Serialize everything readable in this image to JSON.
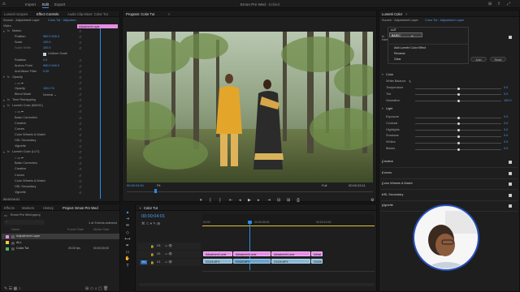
{
  "app": {
    "home_icon": "home-icon",
    "tabs": [
      "Import",
      "Edit",
      "Export"
    ],
    "active_tab": "Edit",
    "project_title": "Emon Pre Wed",
    "edited": "- Edited"
  },
  "effect_controls": {
    "tabs": [
      "Lumetri Scopes",
      "Effect Controls",
      "Audio Clip Mixer: Color Tut"
    ],
    "active_tab": "Effect Controls",
    "source": "Source · Adjustment Layer",
    "target": "Color Tut · Adjustme...",
    "clip_label": "Adjustment Layer",
    "section_video": "Video",
    "rows": [
      {
        "label": "Motion",
        "value": "",
        "indent": 0,
        "fx": true
      },
      {
        "label": "Position",
        "value": "960.0   540.0",
        "indent": 2
      },
      {
        "label": "Scale",
        "value": "100.0",
        "indent": 2
      },
      {
        "label": "Scale Width",
        "value": "100.0",
        "indent": 2,
        "dim": true
      },
      {
        "label": "",
        "value": "Uniform Scale",
        "indent": 3,
        "checkbox": true
      },
      {
        "label": "Rotation",
        "value": "0.0",
        "indent": 2
      },
      {
        "label": "Anchor Point",
        "value": "960.0   540.0",
        "indent": 2
      },
      {
        "label": "Anti-flicker Filter",
        "value": "0.00",
        "indent": 2
      },
      {
        "label": "Opacity",
        "value": "",
        "indent": 0,
        "fx": true
      },
      {
        "label": "",
        "value": "",
        "indent": 2,
        "shapes": true
      },
      {
        "label": "Opacity",
        "value": "100.0 %",
        "indent": 2
      },
      {
        "label": "Blend Mode",
        "value": "Normal",
        "indent": 2,
        "select": true
      },
      {
        "label": "Time Remapping",
        "value": "",
        "indent": 0,
        "fx": true
      },
      {
        "label": "Lumetri Color (BASIC)",
        "value": "",
        "indent": 0,
        "fx": true
      },
      {
        "label": "",
        "value": "",
        "indent": 2,
        "shapes": true
      },
      {
        "label": "Basic Correction",
        "value": "",
        "indent": 2
      },
      {
        "label": "Creative",
        "value": "",
        "indent": 2
      },
      {
        "label": "Curves",
        "value": "",
        "indent": 2
      },
      {
        "label": "Color Wheels & Match",
        "value": "",
        "indent": 2
      },
      {
        "label": "HSL Secondary",
        "value": "",
        "indent": 2
      },
      {
        "label": "Vignette",
        "value": "",
        "indent": 2
      },
      {
        "label": "Lumetri Color (LUT)",
        "value": "",
        "indent": 0,
        "fx": true
      },
      {
        "label": "",
        "value": "",
        "indent": 2,
        "shapes": true
      },
      {
        "label": "Basic Correction",
        "value": "",
        "indent": 2
      },
      {
        "label": "Creative",
        "value": "",
        "indent": 2
      },
      {
        "label": "Curves",
        "value": "",
        "indent": 2
      },
      {
        "label": "Color Wheels & Match",
        "value": "",
        "indent": 2
      },
      {
        "label": "HSL Secondary",
        "value": "",
        "indent": 2
      },
      {
        "label": "Vignette",
        "value": "",
        "indent": 2
      }
    ],
    "timecode": "00:00:04:01"
  },
  "program": {
    "title": "Program: Color Tut",
    "timecode_left": "00:00:04:01",
    "fit": "Fit",
    "quality": "Full",
    "timecode_right": "00:00:33:11"
  },
  "project": {
    "tabs": [
      "Effects",
      "Markers",
      "History",
      "Project: Emon Pre Wed"
    ],
    "active_tab": "Project: Emon Pre Wed",
    "file": "Emon Pre Wed.prproj",
    "selection": "1 of 3 items selected",
    "columns": [
      "Name",
      "Frame Rate",
      "Media Start"
    ],
    "items": [
      {
        "name": "Adjustment Layer",
        "rate": "",
        "start": "",
        "color": "#e48ee4",
        "selected": true
      },
      {
        "name": "ALL",
        "rate": "",
        "start": "",
        "color": "#f1c93a"
      },
      {
        "name": "Color Tut",
        "rate": "25.00 fps",
        "start": "00;00;00;00",
        "color": "#4cb75a"
      }
    ]
  },
  "timeline": {
    "tab": "Color Tut",
    "timecode": "00:00:04:01",
    "ruler": [
      "00:00",
      "00:00:05:00",
      "00:00:10:00"
    ],
    "tracks": [
      {
        "name": "V3",
        "active": false
      },
      {
        "name": "V2",
        "active": false
      },
      {
        "name": "V1",
        "active": true
      }
    ],
    "clips": {
      "v2": [
        "Adjustment Layer",
        "Adjustment Layer",
        "Adjustment Layer",
        "Adjust"
      ],
      "v1": [
        "C0426.MP4",
        "C0426.MP4",
        "C0426.MP4",
        "C0426"
      ]
    }
  },
  "lumetri": {
    "title": "Lumetri Color",
    "source": "Source · Adjustment Layer",
    "target": "Color Tut · Adjustment Layer",
    "menu": {
      "items": [
        "LUT",
        "BASIC"
      ],
      "extra": [
        "Add Lumetri Color Effect",
        "Rename",
        "Clear"
      ],
      "auto": "Auto",
      "reset": "Reset"
    },
    "name_label": "Name",
    "name_value": "LUT",
    "color_section": "Color",
    "white_balance": "White Balance",
    "color_sliders": [
      {
        "label": "Temperature",
        "value": "0.0",
        "pos": 0.5
      },
      {
        "label": "Tint",
        "value": "0.0",
        "pos": 0.5
      },
      {
        "label": "Saturation",
        "value": "100.0",
        "pos": 0.5
      }
    ],
    "light_section": "Light",
    "light_sliders": [
      {
        "label": "Exposure",
        "value": "0.0",
        "pos": 0.5
      },
      {
        "label": "Contrast",
        "value": "0.0",
        "pos": 0.5
      },
      {
        "label": "Highlights",
        "value": "0.0",
        "pos": 0.5
      },
      {
        "label": "Shadows",
        "value": "0.0",
        "pos": 0.5
      },
      {
        "label": "Whites",
        "value": "0.0",
        "pos": 0.5
      },
      {
        "label": "Blacks",
        "value": "0.0",
        "pos": 0.5
      }
    ],
    "sections": [
      "Creative",
      "Curves",
      "Color Wheels & Match",
      "HSL Secondary",
      "Vignette"
    ]
  }
}
